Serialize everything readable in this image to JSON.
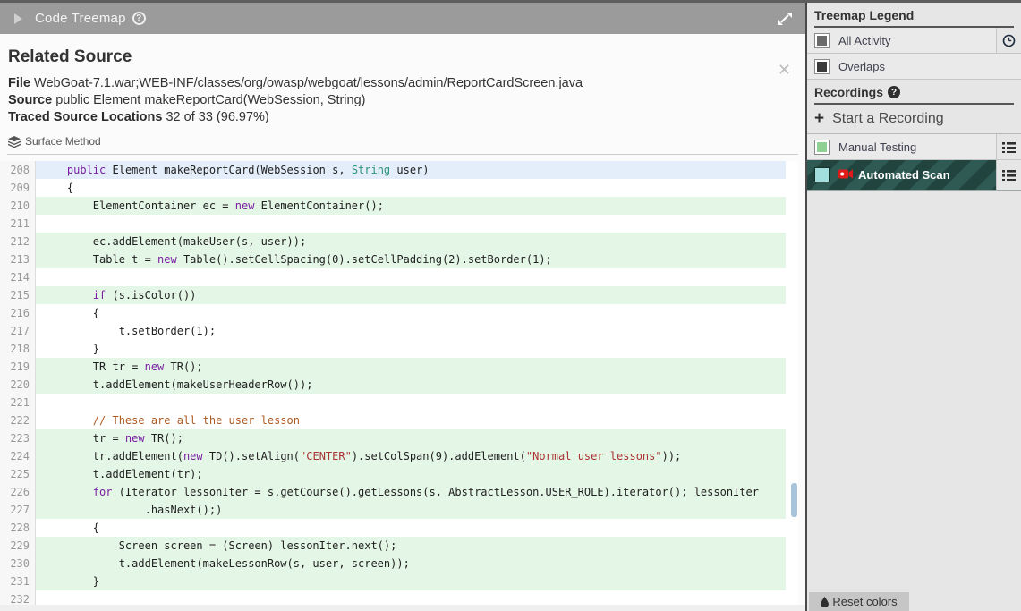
{
  "header": {
    "title": "Code Treemap",
    "help_glyph": "?"
  },
  "panel": {
    "title": "Related Source",
    "close_glyph": "✕",
    "file_label": "File",
    "file_value": "WebGoat-7.1.war;WEB-INF/classes/org/owasp/webgoat/lessons/admin/ReportCardScreen.java",
    "source_label": "Source",
    "source_value": "public Element makeReportCard(WebSession, String)",
    "traced_label": "Traced Source Locations",
    "traced_value": "32 of 33 (96.97%)",
    "surface_method_label": "Surface Method"
  },
  "code": {
    "lines": [
      {
        "n": 208,
        "bg": "blue",
        "parts": [
          [
            "plain",
            "    "
          ],
          [
            "kw",
            "public"
          ],
          [
            "plain",
            " Element makeReportCard(WebSession s, "
          ],
          [
            "type",
            "String"
          ],
          [
            "plain",
            " user)"
          ]
        ]
      },
      {
        "n": 209,
        "bg": "none",
        "parts": [
          [
            "plain",
            "    {"
          ]
        ]
      },
      {
        "n": 210,
        "bg": "green",
        "parts": [
          [
            "plain",
            "        ElementContainer ec = "
          ],
          [
            "kw",
            "new"
          ],
          [
            "plain",
            " ElementContainer();"
          ]
        ]
      },
      {
        "n": 211,
        "bg": "none",
        "parts": []
      },
      {
        "n": 212,
        "bg": "green",
        "parts": [
          [
            "plain",
            "        ec.addElement(makeUser(s, user));"
          ]
        ]
      },
      {
        "n": 213,
        "bg": "green",
        "parts": [
          [
            "plain",
            "        Table t = "
          ],
          [
            "kw",
            "new"
          ],
          [
            "plain",
            " Table().setCellSpacing(0).setCellPadding(2).setBorder(1);"
          ]
        ]
      },
      {
        "n": 214,
        "bg": "none",
        "parts": []
      },
      {
        "n": 215,
        "bg": "green",
        "parts": [
          [
            "plain",
            "        "
          ],
          [
            "kw",
            "if"
          ],
          [
            "plain",
            " (s.isColor())"
          ]
        ]
      },
      {
        "n": 216,
        "bg": "none",
        "parts": [
          [
            "plain",
            "        {"
          ]
        ]
      },
      {
        "n": 217,
        "bg": "none",
        "parts": [
          [
            "plain",
            "            t.setBorder(1);"
          ]
        ]
      },
      {
        "n": 218,
        "bg": "none",
        "parts": [
          [
            "plain",
            "        }"
          ]
        ]
      },
      {
        "n": 219,
        "bg": "green",
        "parts": [
          [
            "plain",
            "        TR tr = "
          ],
          [
            "kw",
            "new"
          ],
          [
            "plain",
            " TR();"
          ]
        ]
      },
      {
        "n": 220,
        "bg": "green",
        "parts": [
          [
            "plain",
            "        t.addElement(makeUserHeaderRow());"
          ]
        ]
      },
      {
        "n": 221,
        "bg": "none",
        "parts": []
      },
      {
        "n": 222,
        "bg": "none",
        "parts": [
          [
            "comment",
            "        // These are all the user lesson"
          ]
        ]
      },
      {
        "n": 223,
        "bg": "green",
        "parts": [
          [
            "plain",
            "        tr = "
          ],
          [
            "kw",
            "new"
          ],
          [
            "plain",
            " TR();"
          ]
        ]
      },
      {
        "n": 224,
        "bg": "green",
        "parts": [
          [
            "plain",
            "        tr.addElement("
          ],
          [
            "kw",
            "new"
          ],
          [
            "plain",
            " TD().setAlign("
          ],
          [
            "str",
            "\"CENTER\""
          ],
          [
            "plain",
            ").setColSpan(9).addElement("
          ],
          [
            "str",
            "\"Normal user lessons\""
          ],
          [
            "plain",
            "));"
          ]
        ]
      },
      {
        "n": 225,
        "bg": "green",
        "parts": [
          [
            "plain",
            "        t.addElement(tr);"
          ]
        ]
      },
      {
        "n": 226,
        "bg": "green",
        "parts": [
          [
            "plain",
            "        "
          ],
          [
            "kw",
            "for"
          ],
          [
            "plain",
            " (Iterator lessonIter = s.getCourse().getLessons(s, AbstractLesson.USER_ROLE).iterator(); lessonIter"
          ]
        ]
      },
      {
        "n": 227,
        "bg": "green",
        "parts": [
          [
            "plain",
            "                .hasNext();)"
          ]
        ]
      },
      {
        "n": 228,
        "bg": "none",
        "parts": [
          [
            "plain",
            "        {"
          ]
        ]
      },
      {
        "n": 229,
        "bg": "green",
        "parts": [
          [
            "plain",
            "            Screen screen = (Screen) lessonIter.next();"
          ]
        ]
      },
      {
        "n": 230,
        "bg": "green",
        "parts": [
          [
            "plain",
            "            t.addElement(makeLessonRow(s, user, screen));"
          ]
        ]
      },
      {
        "n": 231,
        "bg": "green",
        "parts": [
          [
            "plain",
            "        }"
          ]
        ]
      },
      {
        "n": 232,
        "bg": "none",
        "parts": []
      }
    ]
  },
  "sidebar": {
    "legend_title": "Treemap Legend",
    "legend_items": [
      {
        "label": "All Activity",
        "swatch": "#6a6a6a",
        "trailing": "clock"
      },
      {
        "label": "Overlaps",
        "swatch": "#3a3a3a",
        "trailing": "none"
      }
    ],
    "recordings_title": "Recordings",
    "recordings_help_glyph": "?",
    "start_recording_plus": "+",
    "start_recording_label": "Start a Recording",
    "recordings": [
      {
        "label": "Manual Testing",
        "swatch": "#8ed193",
        "selected": false,
        "recording": false
      },
      {
        "label": "Automated Scan",
        "swatch": "#a2dedd",
        "selected": true,
        "recording": true
      }
    ],
    "selected_stripe_colors": [
      "#2e5a53",
      "#22443e"
    ],
    "reset_colors_label": "Reset colors"
  }
}
